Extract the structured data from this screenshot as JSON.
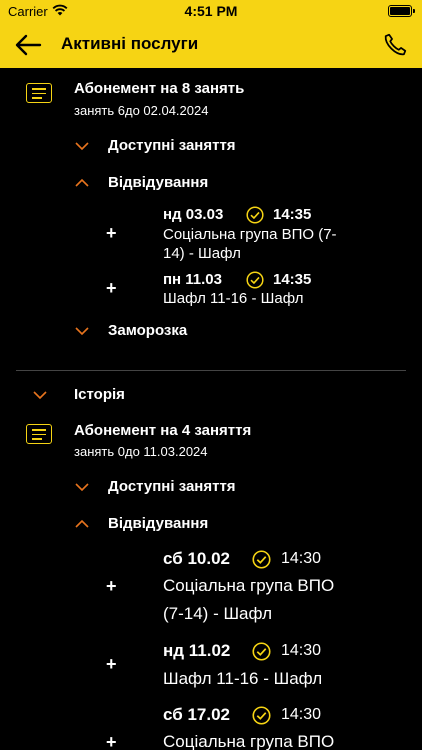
{
  "status_bar": {
    "carrier": "Carrier",
    "time": "4:51 PM"
  },
  "header": {
    "title": "Активні послуги"
  },
  "subscription_1": {
    "title": "Абонемент на 8 занять",
    "meta": "занять 6до 02.04.2024",
    "available_label": "Доступні заняття",
    "visits_label": "Відвідування",
    "visits": [
      {
        "day": "нд 03.03",
        "time": "14:35",
        "group_line1": "Соціальна група ВПО (7-",
        "group_line2": "14) - Шафл"
      },
      {
        "day": "пн 11.03",
        "time": "14:35",
        "group_line1": "Шафл 11-16 - Шафл"
      }
    ],
    "freeze_label": "Заморозка"
  },
  "history": {
    "label": "Історія"
  },
  "subscription_2": {
    "title": "Абонемент на 4 заняття",
    "meta": "занять 0до 11.03.2024",
    "available_label": "Доступні заняття",
    "visits_label": "Відвідування",
    "visits": [
      {
        "day": "сб 10.02",
        "time": "14:30",
        "group_line1": "Соціальна група ВПО",
        "group_line2": "(7-14) - Шафл"
      },
      {
        "day": "нд 11.02",
        "time": "14:30",
        "group_line1": "Шафл 11-16 - Шафл"
      },
      {
        "day": "сб 17.02",
        "time": "14:30",
        "group_line1": "Соціальна група ВПО"
      }
    ]
  },
  "expand_symbol": "+",
  "colors": {
    "accent": "#f6d414",
    "chevron": "#e8741e",
    "background": "#000000",
    "text": "#ffffff"
  }
}
